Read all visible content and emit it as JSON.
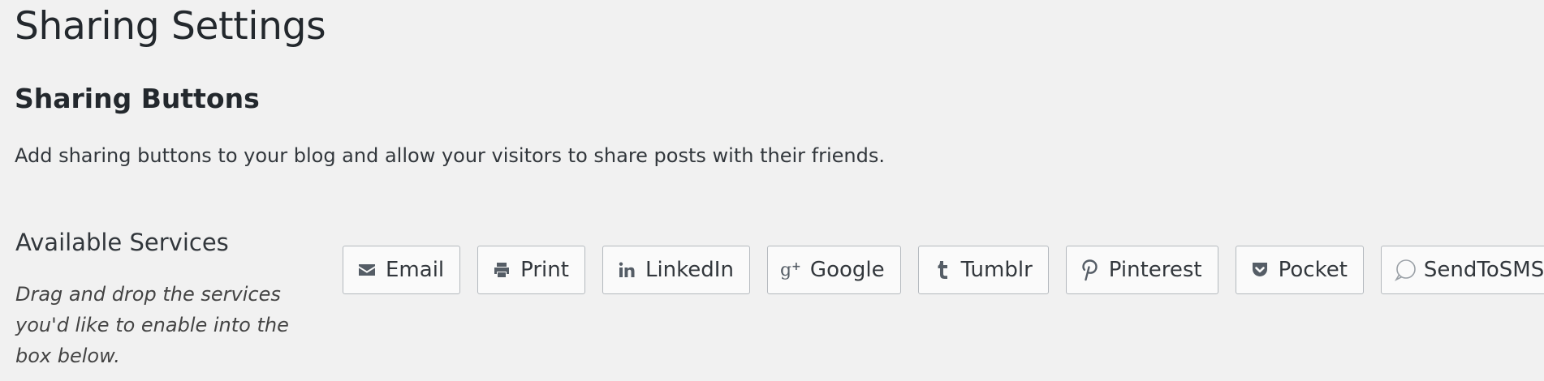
{
  "page": {
    "title": "Sharing Settings"
  },
  "sharing": {
    "heading": "Sharing Buttons",
    "description": "Add sharing buttons to your blog and allow your visitors to share posts with their friends."
  },
  "available_services": {
    "heading": "Available Services",
    "hint": "Drag and drop the services you'd like to enable into the box below.",
    "items": [
      {
        "label": "Email",
        "icon": "envelope-icon"
      },
      {
        "label": "Print",
        "icon": "printer-icon"
      },
      {
        "label": "LinkedIn",
        "icon": "linkedin-icon"
      },
      {
        "label": "Google",
        "icon": "google-plus-icon"
      },
      {
        "label": "Tumblr",
        "icon": "tumblr-icon"
      },
      {
        "label": "Pinterest",
        "icon": "pinterest-icon"
      },
      {
        "label": "Pocket",
        "icon": "pocket-icon"
      },
      {
        "label": "SendToSMS",
        "icon": "sms-bubble-icon"
      }
    ]
  },
  "colors": {
    "background": "#f1f1f1",
    "button_background": "#fafafa",
    "button_border": "#b4b9be",
    "text": "#23282d",
    "icon": "#555d66"
  }
}
